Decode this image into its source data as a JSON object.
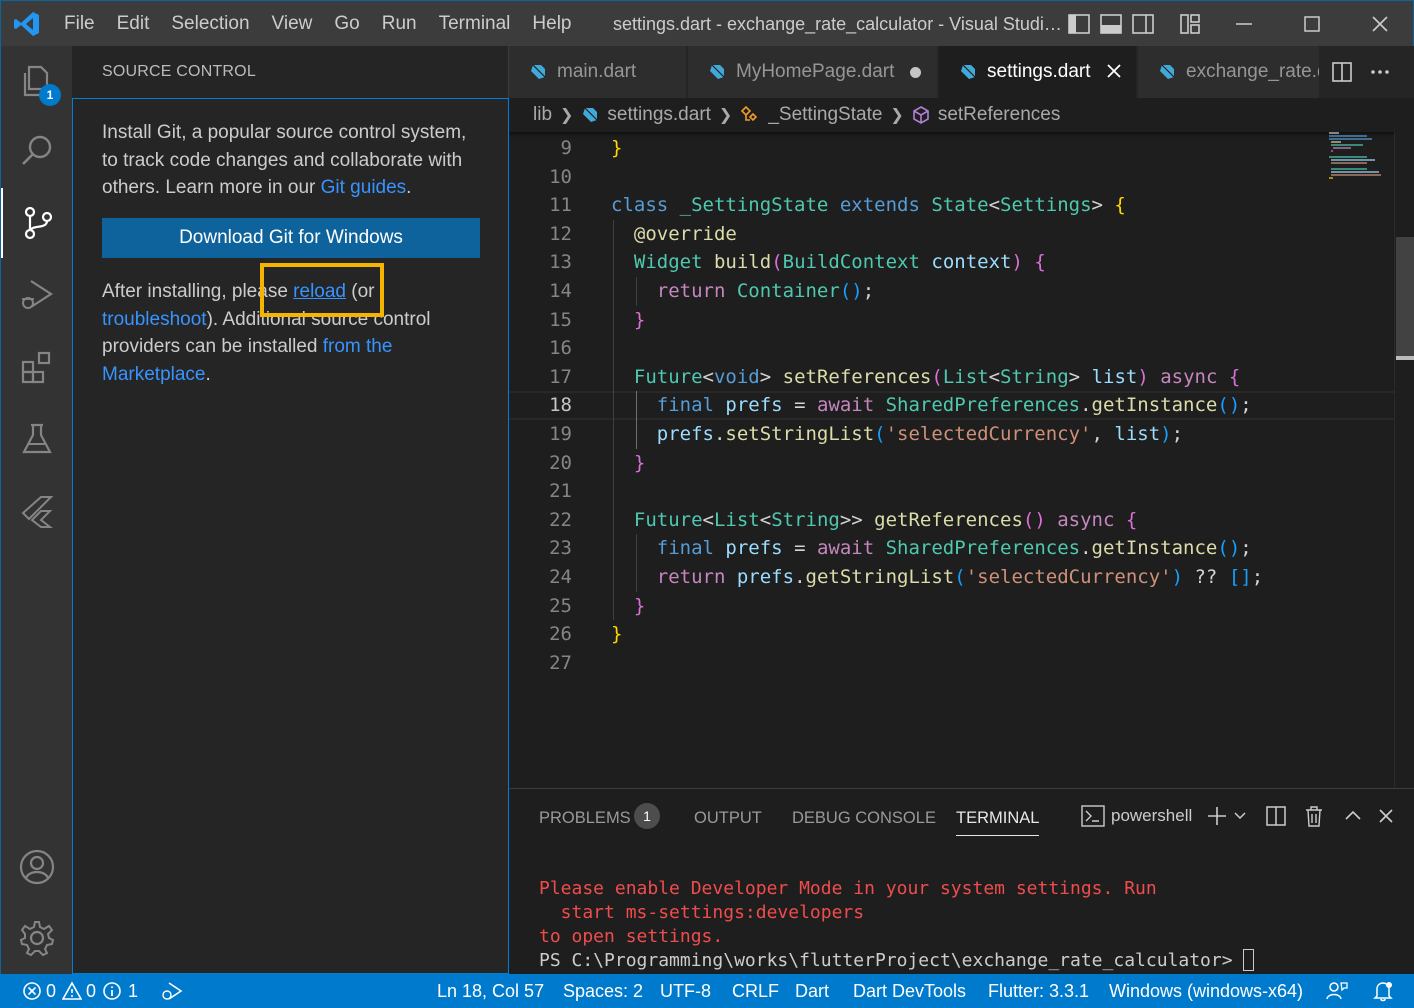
{
  "titlebar": {
    "menus": [
      "File",
      "Edit",
      "Selection",
      "View",
      "Go",
      "Run",
      "Terminal",
      "Help"
    ],
    "window_title": "settings.dart - exchange_rate_calculator - Visual Studio Code"
  },
  "activitybar": {
    "items": [
      "explorer",
      "search",
      "source-control",
      "run-and-debug",
      "extensions",
      "testing",
      "flutter"
    ],
    "active": "source-control",
    "explorer_badge": "1"
  },
  "sidebar": {
    "title": "SOURCE CONTROL",
    "install_text_1": "Install Git, a popular source control system, to track code changes and collaborate with others. Learn more in our ",
    "git_guides_link": "Git guides",
    "install_text_end": ".",
    "download_button": "Download Git for Windows",
    "after_text_1": "After installing, please ",
    "reload_link": "reload",
    "after_text_2": " (or ",
    "troubleshoot_link": "troubleshoot",
    "after_text_3": "). Additional source control providers can be installed ",
    "marketplace_link": "from the Marketplace",
    "after_text_end": "."
  },
  "tabs": [
    {
      "label": "main.dart",
      "active": false,
      "dirty": false
    },
    {
      "label": "MyHomePage.dart",
      "active": false,
      "dirty": true
    },
    {
      "label": "settings.dart",
      "active": true,
      "dirty": false
    },
    {
      "label": "exchange_rate.dart",
      "active": false,
      "dirty": false
    }
  ],
  "breadcrumb": {
    "folder": "lib",
    "file": "settings.dart",
    "class": "_SettingState",
    "method": "setReferences"
  },
  "editor": {
    "current_line": 18,
    "line_numbers": [
      "9",
      "10",
      "11",
      "12",
      "13",
      "14",
      "15",
      "16",
      "17",
      "18",
      "19",
      "20",
      "21",
      "22",
      "23",
      "24",
      "25",
      "26",
      "27"
    ]
  },
  "panel": {
    "tabs": [
      "PROBLEMS",
      "OUTPUT",
      "DEBUG CONSOLE",
      "TERMINAL"
    ],
    "active_tab": "TERMINAL",
    "problems_count": "1",
    "shell_name": "powershell",
    "terminal_lines": [
      "Please enable Developer Mode in your system settings. Run",
      "  start ms-settings:developers",
      "to open settings."
    ],
    "prompt": "PS C:\\Programming\\works\\flutterProject\\exchange_rate_calculator> "
  },
  "statusbar": {
    "errors": "0",
    "warnings": "0",
    "infos": "1",
    "position": "Ln 18, Col 57",
    "spaces": "Spaces: 2",
    "encoding": "UTF-8",
    "eol": "CRLF",
    "language": "Dart",
    "devtools": "Dart DevTools",
    "flutter": "Flutter: 3.3.1",
    "device": "Windows (windows-x64)"
  },
  "colors": {
    "accent": "#007acc",
    "button": "#0e639c",
    "link": "#3794ff",
    "highlight_box": "#f4b400",
    "terminal_error": "#f14c4c"
  }
}
